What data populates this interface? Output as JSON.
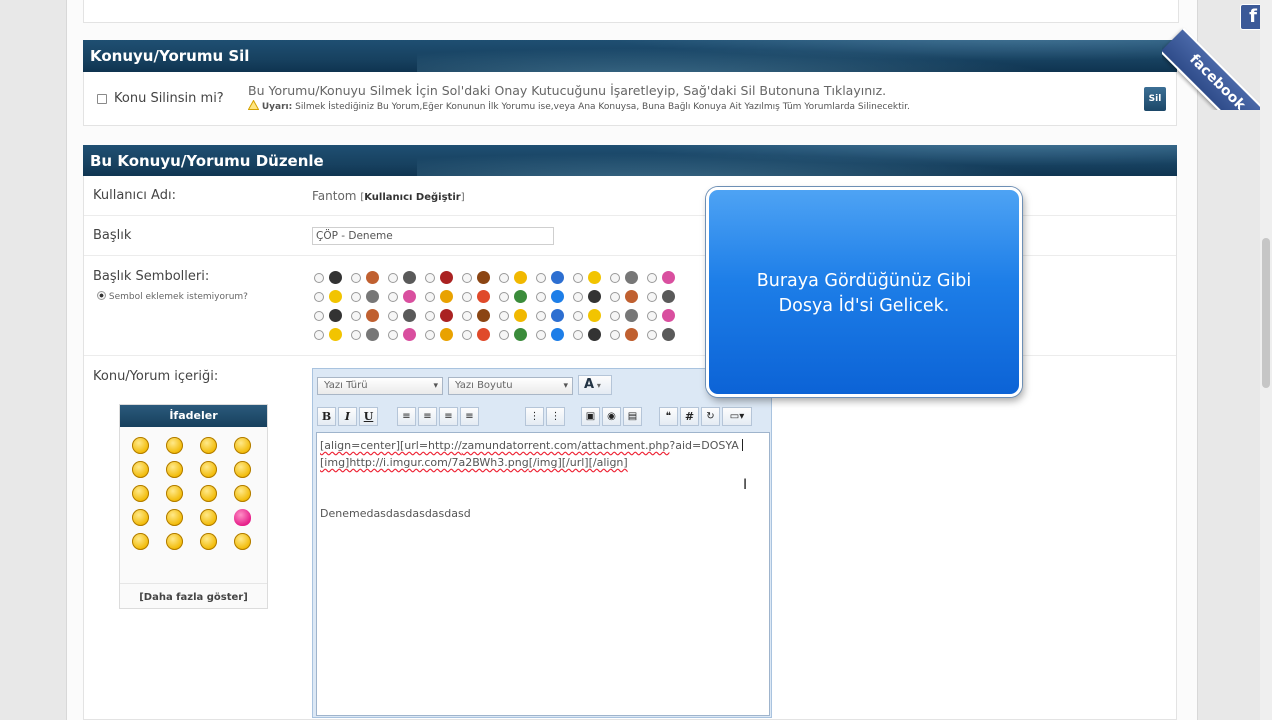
{
  "delete_section": {
    "title": "Konuyu/Yorumu Sil",
    "checkbox_label": "Konu Silinsin mi?",
    "instruction": "Bu Yorumu/Konuyu Silmek İçin Sol'daki Onay Kutucuğunu İşaretleyip, Sağ'daki Sil Butonuna Tıklayınız.",
    "warning_label": "Uyarı:",
    "warning_text": "Silmek İstediğiniz Bu Yorum,Eğer Konunun İlk Yorumu ise,veya Ana Konuysa, Buna Bağlı Konuya Ait Yazılmış Tüm Yorumlarda Silinecektir.",
    "delete_button": "Sil"
  },
  "edit_section": {
    "title": "Bu Konuyu/Yorumu Düzenle",
    "username_label": "Kullanıcı Adı:",
    "username_value": "Fantom",
    "change_user_open": "[",
    "change_user_link": "Kullanıcı Değiştir",
    "change_user_close": "]",
    "title_label": "Başlık",
    "title_value": "ÇÖP - Deneme",
    "symbols_label": "Başlık Sembolleri:",
    "no_symbol_option": "Sembol eklemek istemiyorum?",
    "content_label": "Konu/Yorum içeriği:"
  },
  "smilies": {
    "header": "İfadeler",
    "more_link": "[Daha fazla göster]"
  },
  "editor": {
    "font_select": "Yazı Türü",
    "size_select": "Yazı Boyutu",
    "bold": "B",
    "italic": "I",
    "underline": "U",
    "code_button": "#",
    "line1_a": "[align=center][url=http://",
    "line1_b": "zamundatorrent.com/attachment.php",
    "line1_c": "?aid=DOSYA",
    "line2_a": "[img]http://",
    "line2_b": "i.imgur.com/7a2BWh3.png",
    "line2_c": "[/img][/url][/align]",
    "line3": "Denemedasdasdasdasdasd"
  },
  "callout": {
    "line1": "Buraya Gördüğünüz Gibi",
    "line2": "Dosya İd'si Gelicek."
  },
  "facebook_label": "facebook",
  "colors": {
    "header_blue": "#1a4566",
    "callout_blue": "#1d7ee8",
    "facebook_blue": "#3b5998"
  }
}
